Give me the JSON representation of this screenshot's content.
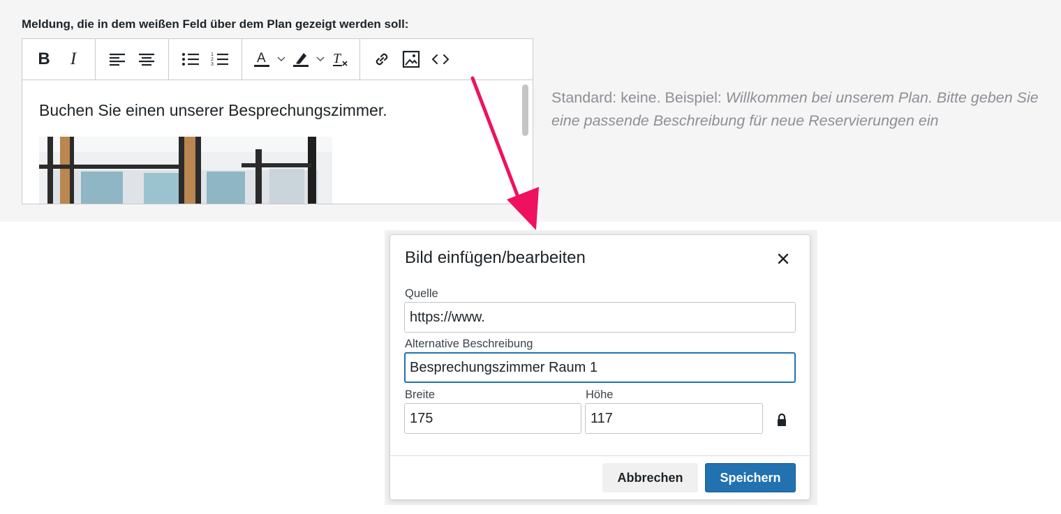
{
  "settings": {
    "field_label": "Meldung, die in dem weißen Feld über dem Plan gezeigt werden soll:",
    "hint_prefix": "Standard: keine. Beispiel: ",
    "hint_example": "Willkommen bei unserem Plan. Bitte geben Sie eine passende Beschreibung für neue Reservierungen ein"
  },
  "toolbar": {
    "bold": "B",
    "italic": "I",
    "text_color": "A"
  },
  "editor": {
    "content_text": "Buchen Sie einen unserer Besprechungszimmer."
  },
  "dialog": {
    "title": "Bild einfügen/bearbeiten",
    "source_label": "Quelle",
    "source_value": "https://www.",
    "alt_label": "Alternative Beschreibung",
    "alt_value": "Besprechungszimmer Raum 1",
    "width_label": "Breite",
    "width_value": "175",
    "height_label": "Höhe",
    "height_value": "117",
    "cancel_label": "Abbrechen",
    "save_label": "Speichern"
  },
  "colors": {
    "accent": "#2271b1",
    "arrow": "#f0115e",
    "hint_text": "#8c8f94"
  },
  "icons": [
    "bold-icon",
    "italic-icon",
    "align-left-icon",
    "align-center-icon",
    "bullet-list-icon",
    "numbered-list-icon",
    "text-color-icon",
    "highlight-icon",
    "clear-format-icon",
    "link-icon",
    "image-icon",
    "code-icon",
    "close-icon",
    "lock-icon"
  ]
}
